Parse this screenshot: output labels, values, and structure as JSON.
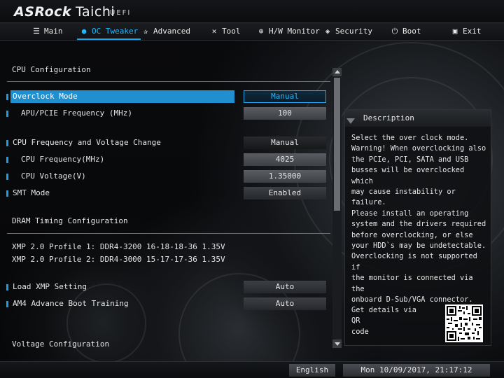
{
  "header": {
    "brand": "ASRock",
    "model": "Taichi",
    "firmware": "UEFI"
  },
  "nav": {
    "tabs": [
      {
        "label": "Main",
        "icon": "list-icon",
        "active": false
      },
      {
        "label": "OC Tweaker",
        "icon": "flame-icon",
        "active": true
      },
      {
        "label": "Advanced",
        "icon": "star-icon",
        "active": false
      },
      {
        "label": "Tool",
        "icon": "tool-icon",
        "active": false
      },
      {
        "label": "H/W Monitor",
        "icon": "monitor-icon",
        "active": false
      },
      {
        "label": "Security",
        "icon": "shield-icon",
        "active": false
      },
      {
        "label": "Boot",
        "icon": "power-icon",
        "active": false
      },
      {
        "label": "Exit",
        "icon": "exit-icon",
        "active": false
      }
    ],
    "accent": "#1fa8f0"
  },
  "content": {
    "sections": {
      "cpu": "CPU Configuration",
      "dram": "DRAM Timing Configuration",
      "voltage": "Voltage Configuration"
    },
    "settings": {
      "overclock_mode": {
        "label": "Overclock Mode",
        "value": "Manual"
      },
      "apu_pcie_freq": {
        "label": "APU/PCIE Frequency (MHz)",
        "value": "100"
      },
      "cpu_freq_voltage_change": {
        "label": "CPU Frequency and Voltage Change",
        "value": "Manual"
      },
      "cpu_frequency": {
        "label": "CPU Frequency(MHz)",
        "value": "4025"
      },
      "cpu_voltage": {
        "label": "CPU Voltage(V)",
        "value": "1.35000"
      },
      "smt_mode": {
        "label": "SMT Mode",
        "value": "Enabled"
      },
      "load_xmp": {
        "label": "Load XMP Setting",
        "value": "Auto"
      },
      "am4_boot_training": {
        "label": "AM4 Advance Boot Training",
        "value": "Auto"
      }
    },
    "xmp_profiles": [
      "XMP 2.0 Profile 1: DDR4-3200 16-18-18-36 1.35V",
      "XMP 2.0 Profile 2: DDR4-3000 15-17-17-36 1.35V"
    ]
  },
  "description": {
    "title": "Description",
    "text": "Select the over clock mode.\nWarning! When overclocking also\nthe PCIe, PCI, SATA and USB\nbusses will be overclocked which\nmay cause instability or failure.\nPlease install an operating\nsystem and the drivers required\nbefore overclocking, or else\nyour HDD`s may be undetectable.\nOverclocking is not supported if\nthe monitor is connected via the\nonboard D-Sub/VGA connector.",
    "qr_text": "Get details via QR\ncode"
  },
  "footer": {
    "language": "English",
    "datetime": "Mon 10/09/2017, 21:17:12"
  }
}
